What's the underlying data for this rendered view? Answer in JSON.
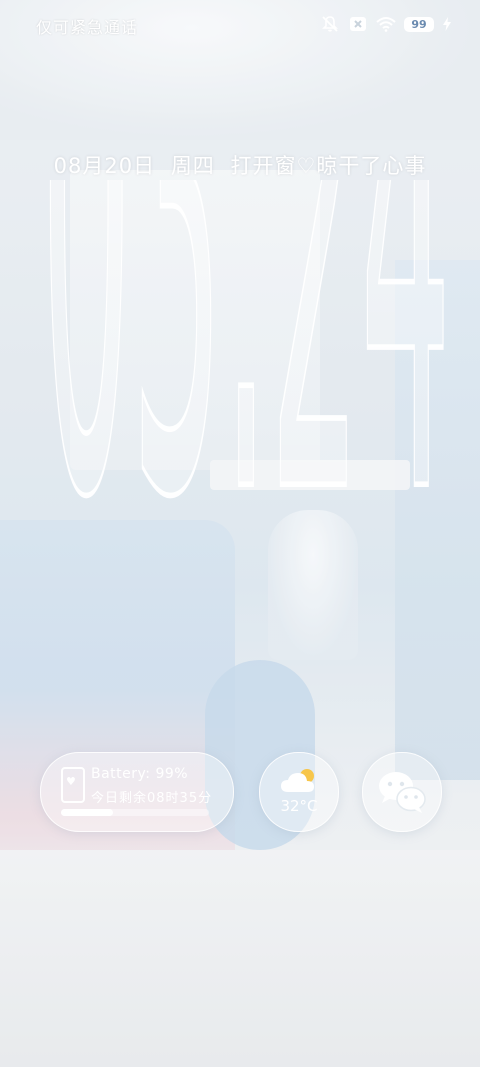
{
  "status_bar": {
    "left_text": "仅可紧急通话",
    "icons": [
      "mute-icon",
      "signal-off-icon",
      "wifi-icon",
      "battery-icon",
      "charging-icon"
    ],
    "battery_level": "99"
  },
  "lock_screen": {
    "date": "08月20日",
    "weekday": "周四",
    "phrase": "打开窗♡晾干了心事",
    "time": "03:24"
  },
  "widgets": {
    "battery": {
      "label": "Battery:",
      "percent": "99%",
      "remaining": "今日剩余08时35分",
      "progress": 0.35,
      "icon": "phone-heart-icon"
    },
    "weather": {
      "temperature": "32°C",
      "icon": "partly-cloudy-icon"
    },
    "wechat": {
      "icon": "wechat-icon"
    }
  },
  "colors": {
    "accent": "#ffffff",
    "battery_text": "#6b8bb0"
  }
}
